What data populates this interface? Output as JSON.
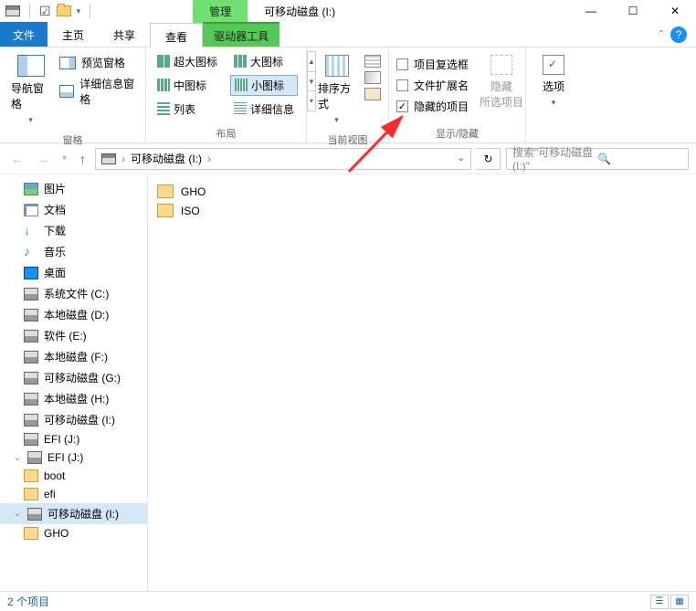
{
  "title": "可移动磁盘 (I:)",
  "manage_tab": "管理",
  "tabs": {
    "file": "文件",
    "home": "主页",
    "share": "共享",
    "view": "查看",
    "drive_tools": "驱动器工具"
  },
  "ribbon": {
    "panes": {
      "nav": "导航窗格",
      "preview": "预览窗格",
      "details": "详细信息窗格",
      "group": "窗格"
    },
    "layout": {
      "xl": "超大图标",
      "lg": "大图标",
      "md": "中图标",
      "sm": "小图标",
      "list": "列表",
      "details": "详细信息",
      "group": "布局"
    },
    "current_view": {
      "sort": "排序方式",
      "group": "当前视图"
    },
    "show_hide": {
      "chk_boxes": "项目复选框",
      "ext": "文件扩展名",
      "hidden": "隐藏的项目",
      "hide_sel": "隐藏\n所选项目",
      "group": "显示/隐藏"
    },
    "options": "选项"
  },
  "address": {
    "path": "可移动磁盘 (I:)"
  },
  "search": {
    "placeholder": "搜索\"可移动磁盘 (I:)\""
  },
  "tree": [
    {
      "icon": "pic",
      "label": "图片",
      "lvl": 1
    },
    {
      "icon": "doc",
      "label": "文档",
      "lvl": 1
    },
    {
      "icon": "dl",
      "label": "下载",
      "lvl": 1
    },
    {
      "icon": "music",
      "label": "音乐",
      "lvl": 1
    },
    {
      "icon": "desk",
      "label": "桌面",
      "lvl": 1
    },
    {
      "icon": "drive",
      "label": "系统文件 (C:)",
      "lvl": 1
    },
    {
      "icon": "drive",
      "label": "本地磁盘 (D:)",
      "lvl": 1
    },
    {
      "icon": "drive",
      "label": "软件 (E:)",
      "lvl": 1
    },
    {
      "icon": "drive",
      "label": "本地磁盘 (F:)",
      "lvl": 1
    },
    {
      "icon": "drive",
      "label": "可移动磁盘 (G:)",
      "lvl": 1
    },
    {
      "icon": "drive",
      "label": "本地磁盘 (H:)",
      "lvl": 1
    },
    {
      "icon": "drive",
      "label": "可移动磁盘 (I:)",
      "lvl": 1
    },
    {
      "icon": "drive",
      "label": "EFI (J:)",
      "lvl": 1
    },
    {
      "icon": "drive",
      "label": "EFI (J:)",
      "lvl": 0,
      "exp": "open"
    },
    {
      "icon": "folder",
      "label": "boot",
      "lvl": 1
    },
    {
      "icon": "folder",
      "label": "efi",
      "lvl": 1
    },
    {
      "icon": "drive",
      "label": "可移动磁盘 (I:)",
      "lvl": 0,
      "exp": "open",
      "selected": true
    },
    {
      "icon": "folder",
      "label": "GHO",
      "lvl": 1
    }
  ],
  "items": [
    {
      "name": "GHO"
    },
    {
      "name": "ISO"
    }
  ],
  "status": "2 个项目"
}
